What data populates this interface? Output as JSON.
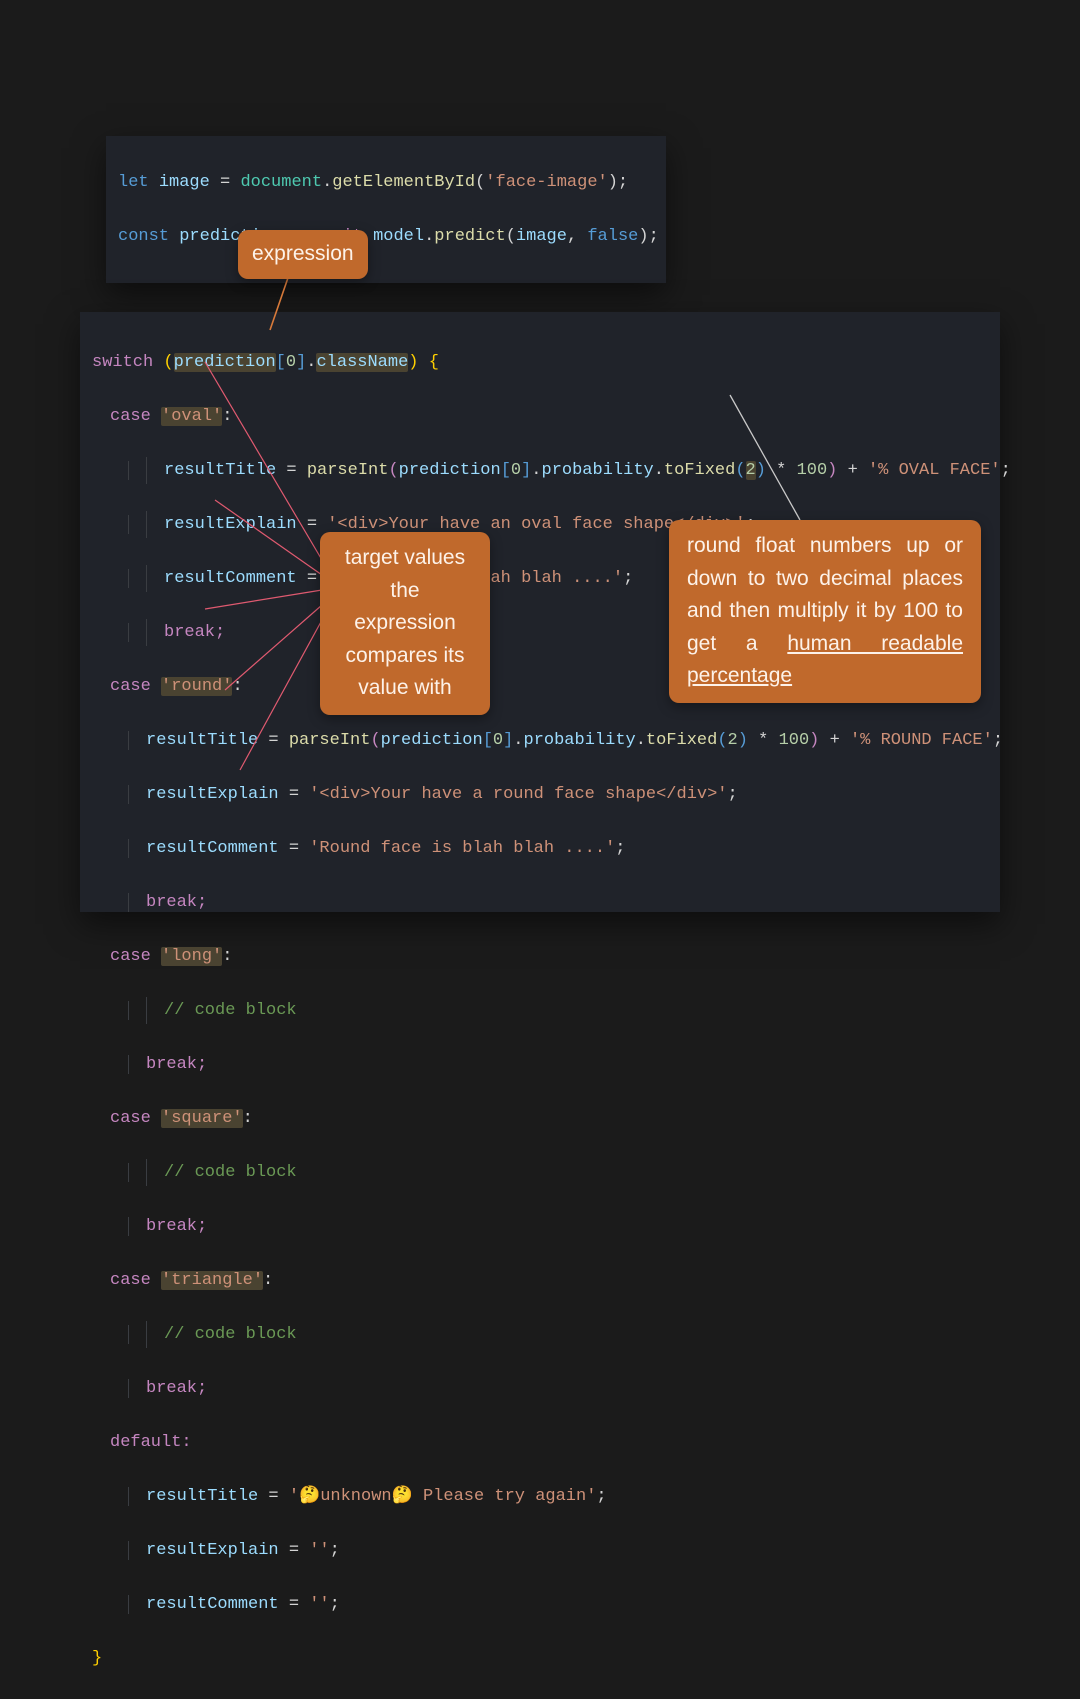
{
  "top": {
    "l1": {
      "kw_let": "let",
      "image": "image",
      "eq": " = ",
      "doc": "document",
      "dot": ".",
      "fn": "getElementById",
      "po": "(",
      "str": "'face-image'",
      "pc": ")",
      "semi": ";"
    },
    "l2": {
      "kw_const": "const",
      "prediction": "prediction",
      "eq": " = ",
      "await": "await",
      "sp": " ",
      "model": "model",
      "dot": ".",
      "fn": "predict",
      "po": "(",
      "arg1": "image",
      "comma": ", ",
      "arg2": "false",
      "pc": ")",
      "semi": ";"
    }
  },
  "code": {
    "switch": "switch",
    "case": "case",
    "break": "break;",
    "default": "default:",
    "pred": "prediction",
    "zero": "0",
    "className": "className",
    "resultTitle": "resultTitle",
    "resultExplain": "resultExplain",
    "resultComment": "resultComment",
    "parseInt": "parseInt",
    "probability": "probability",
    "toFixed": "toFixed",
    "two": "2",
    "mul": " * ",
    "hundred": "100",
    "plus": " + ",
    "oval": "'oval'",
    "round": "'round'",
    "long": "'long'",
    "square": "'square'",
    "triangle": "'triangle'",
    "ovalFace": "'% OVAL FACE'",
    "roundFace": "'% ROUND FACE'",
    "ovalExplain": "'<div>Your have an oval face shape</div>'",
    "roundExplain": "'<div>Your have a round face shape</div>'",
    "ovalComment": "'Oval face is blah blah ....'",
    "roundComment": "'Round face is blah blah ....'",
    "codeBlock": "// code block",
    "unknown": "'🤔unknown🤔 Please try again'",
    "empty": "''",
    "colon": ":",
    "eq": " = ",
    "semi": ";",
    "dot": ".",
    "po": "(",
    "pc": ")",
    "bo": "[",
    "bc": "]",
    "co": "{",
    "cc": "}",
    "sp": " "
  },
  "anno": {
    "expr": "expression",
    "target": "target values the expression compares its value with",
    "round_a": "round float numbers up or down to two decimal places and then multiply it by 100 to get a ",
    "round_u": "human readable percentage"
  }
}
